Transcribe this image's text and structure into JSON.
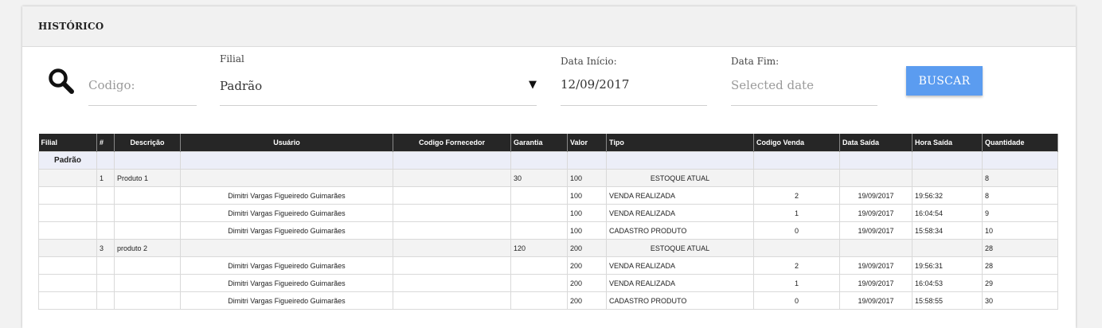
{
  "header": {
    "title": "HISTÓRICO"
  },
  "search": {
    "codigo_placeholder": "Codigo:",
    "filial_label": "Filial",
    "filial_value": "Padrão",
    "data_inicio_label": "Data Início:",
    "data_inicio_value": "12/09/2017",
    "data_fim_label": "Data Fim:",
    "data_fim_placeholder": "Selected date",
    "buscar_label": "BUSCAR",
    "dropdown_caret": "▼"
  },
  "table": {
    "columns": [
      "Filial",
      "#",
      "Descrição",
      "Usuário",
      "Codigo Fornecedor",
      "Garantia",
      "Valor",
      "Tipo",
      "Codigo Venda",
      "Data Saída",
      "Hora Saída",
      "Quantidade"
    ],
    "group_name": "Padrão",
    "rows": [
      {
        "kind": "prod",
        "filial": "",
        "num": "1",
        "descricao": "Produto 1",
        "usuario": "",
        "fornecedor": "",
        "garantia": "30",
        "valor": "100",
        "tipo": "ESTOQUE ATUAL",
        "codigo_venda": "",
        "data_saida": "",
        "hora_saida": "",
        "quantidade": "8"
      },
      {
        "kind": "mov",
        "filial": "",
        "num": "",
        "descricao": "",
        "usuario": "Dimitri Vargas Figueiredo Guimarães",
        "fornecedor": "",
        "garantia": "",
        "valor": "100",
        "tipo": "VENDA REALIZADA",
        "codigo_venda": "2",
        "data_saida": "19/09/2017",
        "hora_saida": "19:56:32",
        "quantidade": "8"
      },
      {
        "kind": "mov",
        "filial": "",
        "num": "",
        "descricao": "",
        "usuario": "Dimitri Vargas Figueiredo Guimarães",
        "fornecedor": "",
        "garantia": "",
        "valor": "100",
        "tipo": "VENDA REALIZADA",
        "codigo_venda": "1",
        "data_saida": "19/09/2017",
        "hora_saida": "16:04:54",
        "quantidade": "9"
      },
      {
        "kind": "mov",
        "filial": "",
        "num": "",
        "descricao": "",
        "usuario": "Dimitri Vargas Figueiredo Guimarães",
        "fornecedor": "",
        "garantia": "",
        "valor": "100",
        "tipo": "CADASTRO PRODUTO",
        "codigo_venda": "0",
        "data_saida": "19/09/2017",
        "hora_saida": "15:58:34",
        "quantidade": "10"
      },
      {
        "kind": "prod",
        "filial": "",
        "num": "3",
        "descricao": "produto 2",
        "usuario": "",
        "fornecedor": "",
        "garantia": "120",
        "valor": "200",
        "tipo": "ESTOQUE ATUAL",
        "codigo_venda": "",
        "data_saida": "",
        "hora_saida": "",
        "quantidade": "28"
      },
      {
        "kind": "mov",
        "filial": "",
        "num": "",
        "descricao": "",
        "usuario": "Dimitri Vargas Figueiredo Guimarães",
        "fornecedor": "",
        "garantia": "",
        "valor": "200",
        "tipo": "VENDA REALIZADA",
        "codigo_venda": "2",
        "data_saida": "19/09/2017",
        "hora_saida": "19:56:31",
        "quantidade": "28"
      },
      {
        "kind": "mov",
        "filial": "",
        "num": "",
        "descricao": "",
        "usuario": "Dimitri Vargas Figueiredo Guimarães",
        "fornecedor": "",
        "garantia": "",
        "valor": "200",
        "tipo": "VENDA REALIZADA",
        "codigo_venda": "1",
        "data_saida": "19/09/2017",
        "hora_saida": "16:04:53",
        "quantidade": "29"
      },
      {
        "kind": "mov",
        "filial": "",
        "num": "",
        "descricao": "",
        "usuario": "Dimitri Vargas Figueiredo Guimarães",
        "fornecedor": "",
        "garantia": "",
        "valor": "200",
        "tipo": "CADASTRO PRODUTO",
        "codigo_venda": "0",
        "data_saida": "19/09/2017",
        "hora_saida": "15:58:55",
        "quantidade": "30"
      }
    ]
  },
  "icons": {
    "search": "search-icon",
    "dropdown": "chevron-down-icon"
  },
  "colors": {
    "header_bg": "#262626",
    "button_bg": "#5b9cf0",
    "group_bg": "#eceef8"
  }
}
